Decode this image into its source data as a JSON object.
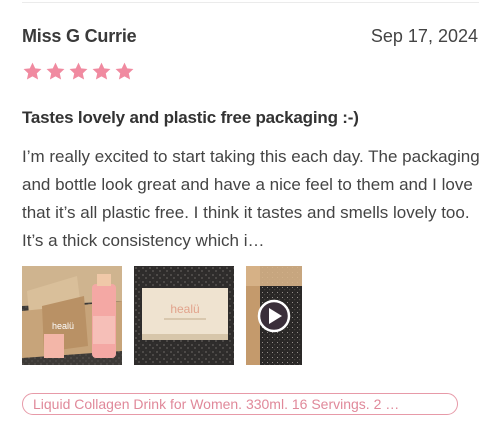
{
  "review": {
    "reviewer": "Miss G Currie",
    "date": "Sep 17, 2024",
    "rating": 5,
    "rating_max": 5,
    "title": "Tastes lovely and plastic free packaging :-)",
    "body": "I’m really excited to start taking this each day. The packaging and bottle look great and have a nice feel to them and I love that it’s all plastic free. I think it tastes and smells lovely too. It’s a thick consistency which i…",
    "media_brand": "healü",
    "product_tag": "Liquid Collagen Drink for Women. 330ml. 16 Servings. 2 …"
  },
  "colors": {
    "star": "#f08aa0",
    "tag_border": "#e79aa8",
    "tag_text": "#e0899a"
  },
  "icons": {
    "star": "star-icon",
    "play": "play-icon"
  }
}
